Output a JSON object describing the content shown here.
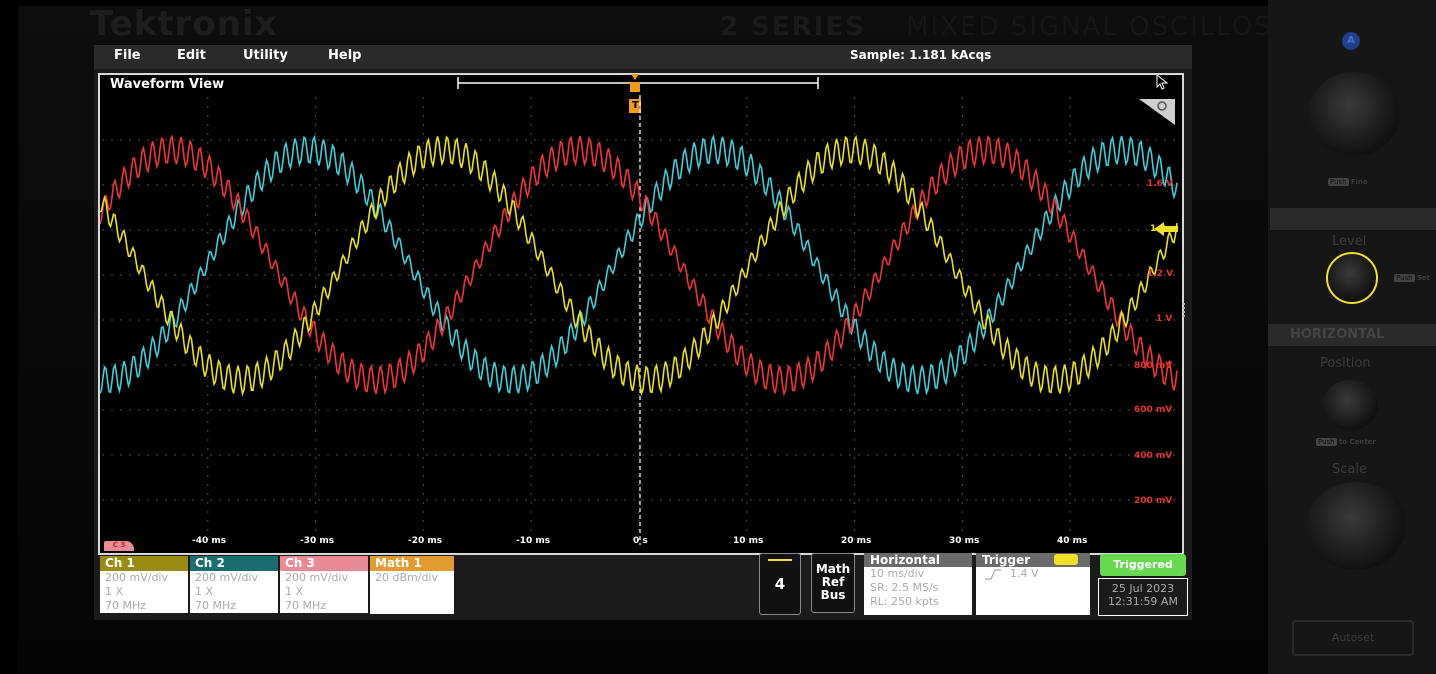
{
  "device": {
    "brand": "Tektronix",
    "series": "2 SERIES",
    "model_desc": "MIXED SIGNAL OSCILLOSCOPE"
  },
  "menubar": {
    "items": [
      "File",
      "Edit",
      "Utility",
      "Help"
    ],
    "acquisition": "Sample: 1.181 kAcqs"
  },
  "waveform_view": {
    "title": "Waveform View",
    "trigger_marker": "T",
    "x_ticks": [
      "-40 ms",
      "-30 ms",
      "-20 ms",
      "-10 ms",
      "0 s",
      "10 ms",
      "20 ms",
      "30 ms",
      "40 ms"
    ],
    "y_ticks": [
      "1.6 V",
      "1.4",
      "1.2 V",
      "1 V",
      "800 mV",
      "600 mV",
      "400 mV",
      "200 mV"
    ],
    "trigger_level_marker": "1.4",
    "channel_marker": "C 3"
  },
  "channels": [
    {
      "label": "Ch 1",
      "scale": "200 mV/div",
      "probe": "1 X",
      "bandwidth": "70 MHz",
      "color": "#e8e21c",
      "header_bg": "#9a8c12"
    },
    {
      "label": "Ch 2",
      "scale": "200 mV/div",
      "probe": "1 X",
      "bandwidth": "70 MHz",
      "color": "#3ecfd8",
      "header_bg": "#1a6e72"
    },
    {
      "label": "Ch 3",
      "scale": "200 mV/div",
      "probe": "1 X",
      "bandwidth": "70 MHz",
      "color": "#f0353a",
      "header_bg": "#e98a94"
    },
    {
      "label": "Math 1",
      "scale": "20 dBm/div",
      "color": "#e39a2f",
      "header_bg": "#e39a2f"
    }
  ],
  "controls": {
    "channel_count_button": "4",
    "math_ref_bus": [
      "Math",
      "Ref",
      "Bus"
    ]
  },
  "horizontal": {
    "title": "Horizontal",
    "scale": "10 ms/div",
    "sample_rate": "SR: 2.5 MS/s",
    "record_length": "RL: 250 kpts"
  },
  "trigger": {
    "title": "Trigger",
    "level": "1.4 V",
    "slope_icon": "rising-edge-icon"
  },
  "status": {
    "state": "Triggered",
    "date": "25 Jul 2023",
    "time": "12:31:59 AM"
  },
  "front_panel": {
    "push_fine": "Fine",
    "level_label": "Level",
    "push_set": "Set",
    "horizontal_label": "HORIZONTAL",
    "position_label": "Position",
    "push_center": "to Center",
    "scale_label": "Scale",
    "autoset_label": "Autoset",
    "push_word": "Push",
    "a_badge": "A"
  }
}
